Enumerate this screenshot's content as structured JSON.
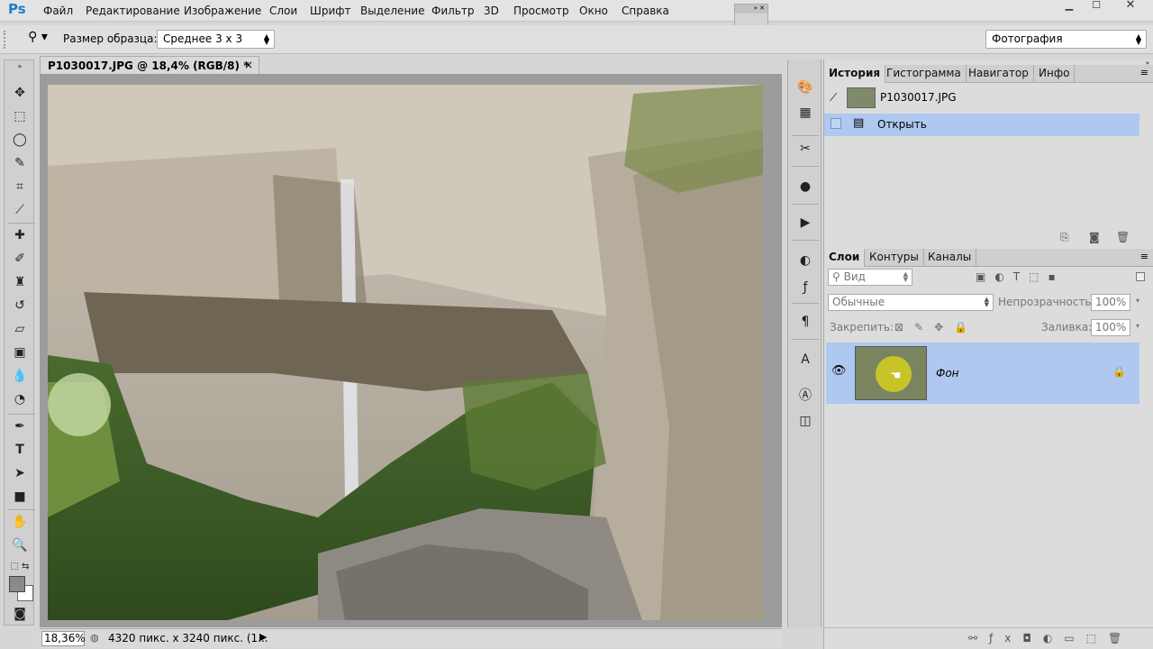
{
  "app": {
    "logo": "Ps"
  },
  "menu": [
    "Файл",
    "Редактирование",
    "Изображение",
    "Слои",
    "Шрифт",
    "Выделение",
    "Фильтр",
    "3D",
    "Просмотр",
    "Окно",
    "Справка"
  ],
  "options_bar": {
    "sample_size_label": "Размер образца:",
    "sample_size_value": "Среднее 3 х 3",
    "workspace": "Фотография"
  },
  "document": {
    "tab_title": "P1030017.JPG @ 18,4% (RGB/8) *",
    "close_glyph": "×",
    "zoom": "18,36%",
    "size_info": "4320 пикс. х 3240 пикс. (1..."
  },
  "history_panel": {
    "tabs": [
      "История",
      "Гистограмма",
      "Навигатор",
      "Инфо"
    ],
    "snapshot_name": "P1030017.JPG",
    "steps": [
      "Открыть"
    ]
  },
  "layers_panel": {
    "tabs": [
      "Слои",
      "Контуры",
      "Каналы"
    ],
    "filter_label": "Вид",
    "blend_mode": "Обычные",
    "opacity_label": "Непрозрачность:",
    "opacity_value": "100%",
    "lock_label": "Закрепить:",
    "fill_label": "Заливка:",
    "fill_value": "100%",
    "layers": [
      {
        "name": "Фон"
      }
    ]
  },
  "colors": {
    "accent": "#aec8f0",
    "logo": "#1e80c8"
  }
}
